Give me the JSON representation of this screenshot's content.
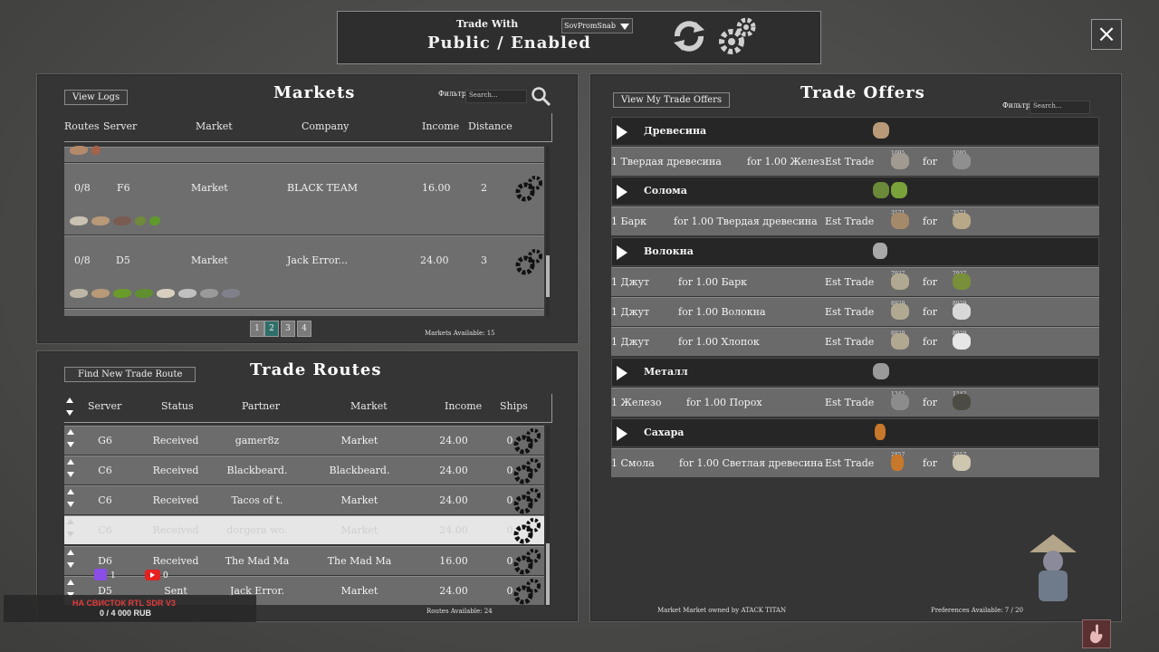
{
  "top_bar": {
    "trade_with_label": "Trade With",
    "trade_mode": "Public / Enabled",
    "company_select": "SovPromSnab"
  },
  "markets": {
    "title": "Markets",
    "view_logs": "View Logs",
    "filter_label": "Фильтр:",
    "search_placeholder": "Search...",
    "headers": [
      "Routes",
      "Server",
      "Market",
      "Company",
      "Income",
      "Distance"
    ],
    "rows": [
      {
        "routes": "0/8",
        "server": "F6",
        "market": "Market",
        "company": "BLACK TEAM",
        "income": "16.00",
        "distance": "2"
      },
      {
        "routes": "0/8",
        "server": "D5",
        "market": "Market",
        "company": "Jack Error...",
        "income": "24.00",
        "distance": "3"
      }
    ],
    "pages": [
      "1",
      "2",
      "3",
      "4"
    ],
    "available": "Markets Available: 15"
  },
  "routes": {
    "title": "Trade Routes",
    "find_button": "Find New Trade Route",
    "headers": [
      "Server",
      "Status",
      "Partner",
      "Market",
      "Income",
      "Ships"
    ],
    "rows": [
      {
        "server": "G6",
        "status": "Received",
        "partner": "gamer8z",
        "market": "Market",
        "income": "24.00",
        "ships": "0"
      },
      {
        "server": "C6",
        "status": "Received",
        "partner": "Blackbeard.",
        "market": "Blackbeard.",
        "income": "24.00",
        "ships": "0"
      },
      {
        "server": "C6",
        "status": "Received",
        "partner": "Tacos of t.",
        "market": "Market",
        "income": "24.00",
        "ships": "0"
      },
      {
        "server": "C6",
        "status": "Received",
        "partner": "dorgera wo.",
        "market": "Market",
        "income": "24.00",
        "ships": "0"
      },
      {
        "server": "D6",
        "status": "Received",
        "partner": "The Mad Ma",
        "market": "The Mad Ma",
        "income": "16.00",
        "ships": "0"
      },
      {
        "server": "D5",
        "status": "Sent",
        "partner": "Jack Error.",
        "market": "Market",
        "income": "24.00",
        "ships": "0"
      }
    ],
    "available": "Routes Available: 24"
  },
  "offers": {
    "title": "Trade Offers",
    "view_my": "View My Trade Offers",
    "filter_label": "Фильтр:",
    "search_placeholder": "Search...",
    "categories": {
      "wood": "Древесина",
      "straw": "Солома",
      "fiber": "Волокна",
      "metal": "Металл",
      "sugar": "Сахара"
    },
    "items": [
      {
        "give": "1 Твердая древесина",
        "want": "for 1.00 Желез",
        "est": "Est Trade",
        "for": "for",
        "n1": "1095",
        "n2": "1095"
      },
      {
        "give": "1 Барк",
        "want": "for 1.00 Твердая древесина",
        "est": "Est Trade",
        "for": "for",
        "n1": "3571",
        "n2": "3571"
      },
      {
        "give": "1 Джут",
        "want": "for 1.00 Барк",
        "est": "Est Trade",
        "for": "for",
        "n1": "7937",
        "n2": "7937"
      },
      {
        "give": "1 Джут",
        "want": "for 1.00 Волокна",
        "est": "Est Trade",
        "for": "for",
        "n1": "8929",
        "n2": "8929"
      },
      {
        "give": "1 Джут",
        "want": "for 1.00 Хлопок",
        "est": "Est Trade",
        "for": "for",
        "n1": "8929",
        "n2": "8929"
      },
      {
        "give": "1 Железо",
        "want": "for 1.00 Порох",
        "est": "Est Trade",
        "for": "for",
        "n1": "1242",
        "n2": "1242"
      },
      {
        "give": "1 Смола",
        "want": "for 1.00 Светлая древесина",
        "est": "Est Trade",
        "for": "for",
        "n1": "2857",
        "n2": "2857"
      }
    ],
    "market_owner": "Market Market owned by ATACK TITAN",
    "preferences": "Preferences Available: 7 / 20"
  },
  "overlay": {
    "twitch_count": "1",
    "youtube_count": "0",
    "goal_title": "НА СВИСТОК RTL SDR V3",
    "goal_value": "0 / 4 000 RUB"
  },
  "colors": {
    "accent_page": "#2f6f6a",
    "twitch": "#8a4de6",
    "youtube": "#e52020",
    "goal_red": "#e23b3b"
  }
}
